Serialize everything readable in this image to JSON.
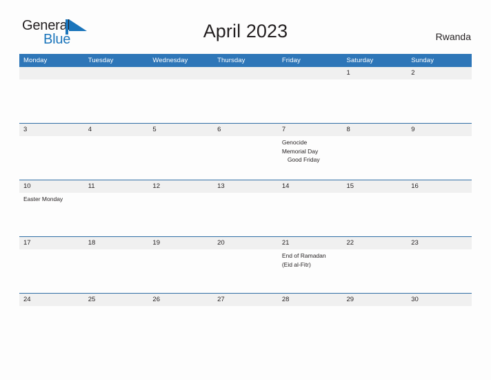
{
  "brand": {
    "name_part1": "General",
    "name_part2": "Blue",
    "flag_icon": "blue-triangle-flag-icon",
    "color_primary": "#1b75bb",
    "color_text": "#231f20"
  },
  "header": {
    "title": "April 2023",
    "country": "Rwanda"
  },
  "calendar": {
    "header_bg": "#2e76b8",
    "row_divider": "#2e6da4",
    "daynum_bg": "#f0f0f0",
    "weekday_headers": [
      "Monday",
      "Tuesday",
      "Wednesday",
      "Thursday",
      "Friday",
      "Saturday",
      "Sunday"
    ],
    "weeks": [
      [
        {
          "day": "",
          "events": []
        },
        {
          "day": "",
          "events": []
        },
        {
          "day": "",
          "events": []
        },
        {
          "day": "",
          "events": []
        },
        {
          "day": "",
          "events": []
        },
        {
          "day": "1",
          "events": []
        },
        {
          "day": "2",
          "events": []
        }
      ],
      [
        {
          "day": "3",
          "events": []
        },
        {
          "day": "4",
          "events": []
        },
        {
          "day": "5",
          "events": []
        },
        {
          "day": "6",
          "events": []
        },
        {
          "day": "7",
          "events": [
            {
              "text": "Genocide",
              "indent": false
            },
            {
              "text": "Memorial Day",
              "indent": false
            },
            {
              "text": "Good Friday",
              "indent": true
            }
          ]
        },
        {
          "day": "8",
          "events": []
        },
        {
          "day": "9",
          "events": []
        }
      ],
      [
        {
          "day": "10",
          "events": [
            {
              "text": "Easter Monday",
              "indent": false
            }
          ]
        },
        {
          "day": "11",
          "events": []
        },
        {
          "day": "12",
          "events": []
        },
        {
          "day": "13",
          "events": []
        },
        {
          "day": "14",
          "events": []
        },
        {
          "day": "15",
          "events": []
        },
        {
          "day": "16",
          "events": []
        }
      ],
      [
        {
          "day": "17",
          "events": []
        },
        {
          "day": "18",
          "events": []
        },
        {
          "day": "19",
          "events": []
        },
        {
          "day": "20",
          "events": []
        },
        {
          "day": "21",
          "events": [
            {
              "text": "End of Ramadan",
              "indent": false
            },
            {
              "text": "(Eid al-Fitr)",
              "indent": false
            }
          ]
        },
        {
          "day": "22",
          "events": []
        },
        {
          "day": "23",
          "events": []
        }
      ],
      [
        {
          "day": "24",
          "events": []
        },
        {
          "day": "25",
          "events": []
        },
        {
          "day": "26",
          "events": []
        },
        {
          "day": "27",
          "events": []
        },
        {
          "day": "28",
          "events": []
        },
        {
          "day": "29",
          "events": []
        },
        {
          "day": "30",
          "events": []
        }
      ]
    ]
  }
}
